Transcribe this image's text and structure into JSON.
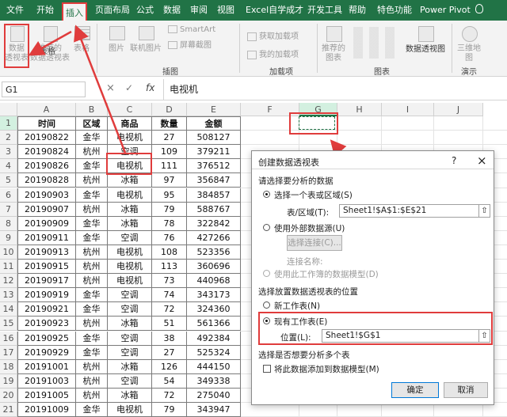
{
  "menu": [
    "文件",
    "开始",
    "插入",
    "页面布局",
    "公式",
    "数据",
    "审阅",
    "视图",
    "Excel自学成才",
    "开发工具",
    "帮助",
    "特色功能",
    "Power Pivot"
  ],
  "lightbulb_icon": "lightbulb-icon",
  "ribbon": {
    "pivot_btn": [
      "数据",
      "透视表"
    ],
    "recommended_pivot": [
      "推荐的",
      "数据透视表"
    ],
    "table": "表格",
    "picture": "图片",
    "online_picture": [
      "联机图片"
    ],
    "smartart": "SmartArt",
    "screenshot": "屏幕截图",
    "get_addins": "获取加载项",
    "my_addins": "我的加载项",
    "recommended_chart": [
      "推荐的",
      "图表"
    ],
    "pivot_chart": "数据透视图",
    "map3d": [
      "三维地",
      "图"
    ],
    "groups": [
      "表格",
      "插图",
      "加载项",
      "图表",
      "演示"
    ]
  },
  "formula_bar": {
    "name_box": "G1",
    "cancel": "×",
    "enter": "✓",
    "fx": "fx",
    "value": "电视机"
  },
  "columns": [
    "A",
    "B",
    "C",
    "D",
    "E",
    "F",
    "G",
    "H",
    "I",
    "J"
  ],
  "table": {
    "headers": [
      "时间",
      "区域",
      "商品",
      "数量",
      "金额"
    ],
    "rows": [
      [
        "20190822",
        "金华",
        "电视机",
        "27",
        "508127"
      ],
      [
        "20190824",
        "杭州",
        "空调",
        "109",
        "379211"
      ],
      [
        "20190826",
        "金华",
        "电视机",
        "111",
        "376512"
      ],
      [
        "20190828",
        "杭州",
        "冰箱",
        "97",
        "356847"
      ],
      [
        "20190903",
        "金华",
        "电视机",
        "95",
        "384857"
      ],
      [
        "20190907",
        "杭州",
        "冰箱",
        "79",
        "588767"
      ],
      [
        "20190909",
        "金华",
        "冰箱",
        "78",
        "322842"
      ],
      [
        "20190911",
        "金华",
        "空调",
        "76",
        "427266"
      ],
      [
        "20190913",
        "杭州",
        "电视机",
        "108",
        "523356"
      ],
      [
        "20190915",
        "杭州",
        "电视机",
        "113",
        "360696"
      ],
      [
        "20190917",
        "杭州",
        "电视机",
        "73",
        "440968"
      ],
      [
        "20190919",
        "金华",
        "空调",
        "74",
        "343173"
      ],
      [
        "20190921",
        "金华",
        "空调",
        "72",
        "324360"
      ],
      [
        "20190923",
        "杭州",
        "冰箱",
        "51",
        "561366"
      ],
      [
        "20190925",
        "金华",
        "空调",
        "38",
        "492384"
      ],
      [
        "20190929",
        "金华",
        "空调",
        "27",
        "525324"
      ],
      [
        "20191001",
        "杭州",
        "冰箱",
        "126",
        "444150"
      ],
      [
        "20191003",
        "杭州",
        "空调",
        "54",
        "349338"
      ],
      [
        "20191005",
        "杭州",
        "冰箱",
        "72",
        "275040"
      ],
      [
        "20191009",
        "金华",
        "电视机",
        "79",
        "343947"
      ]
    ]
  },
  "dialog": {
    "title": "创建数据透视表",
    "help": "?",
    "close": "×",
    "section1": "请选择要分析的数据",
    "opt_select_table": "选择一个表或区域(S)",
    "range_label": "表/区域(T):",
    "range_value": "Sheet1!$A$1:$E$21",
    "opt_external": "使用外部数据源(U)",
    "choose_conn": "选择连接(C)...",
    "conn_name": "连接名称:",
    "opt_data_model": "使用此工作簿的数据模型(D)",
    "section2": "选择放置数据透视表的位置",
    "opt_new_sheet": "新工作表(N)",
    "opt_existing": "现有工作表(E)",
    "location_label": "位置(L):",
    "location_value": "Sheet1!$G$1",
    "section3": "选择是否想要分析多个表",
    "add_to_model": "将此数据添加到数据模型(M)",
    "ok": "确定",
    "cancel": "取消"
  },
  "colors": {
    "excel_green": "#217346",
    "highlight_red": "#e03c3c"
  }
}
